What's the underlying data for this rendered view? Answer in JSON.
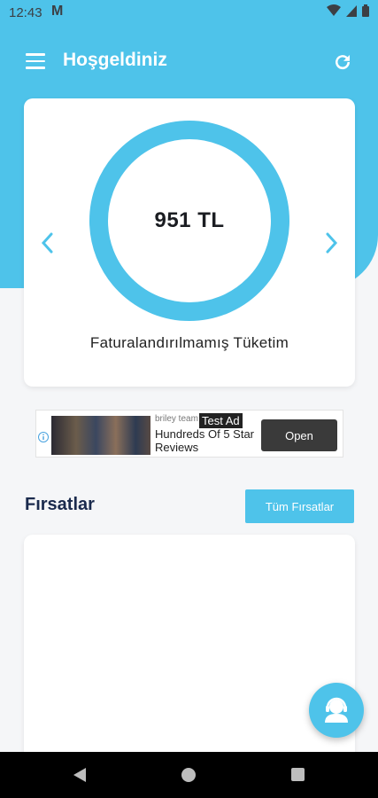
{
  "status_bar": {
    "time": "12:43",
    "mail_glyph": "M"
  },
  "app_bar": {
    "title": "Hoşgeldiniz"
  },
  "summary": {
    "amount": "951 TL",
    "label": "Faturalandırılmamış Tüketim"
  },
  "ad": {
    "advertiser": "briley team",
    "tag": "Test Ad",
    "headline": "Hundreds Of 5 Star Reviews",
    "open_label": "Open"
  },
  "deals": {
    "title": "Fırsatlar",
    "all_button": "Tüm Fırsatlar"
  },
  "colors": {
    "accent": "#4ec3ea",
    "title_navy": "#1a2a4d",
    "background": "#f5f6f8"
  },
  "icons": [
    "menu-icon",
    "refresh-icon",
    "chevron-left-icon",
    "chevron-right-icon",
    "ad-info-icon",
    "support-agent-icon",
    "wifi-icon",
    "signal-icon",
    "battery-icon",
    "back-icon",
    "home-icon",
    "recents-icon"
  ]
}
